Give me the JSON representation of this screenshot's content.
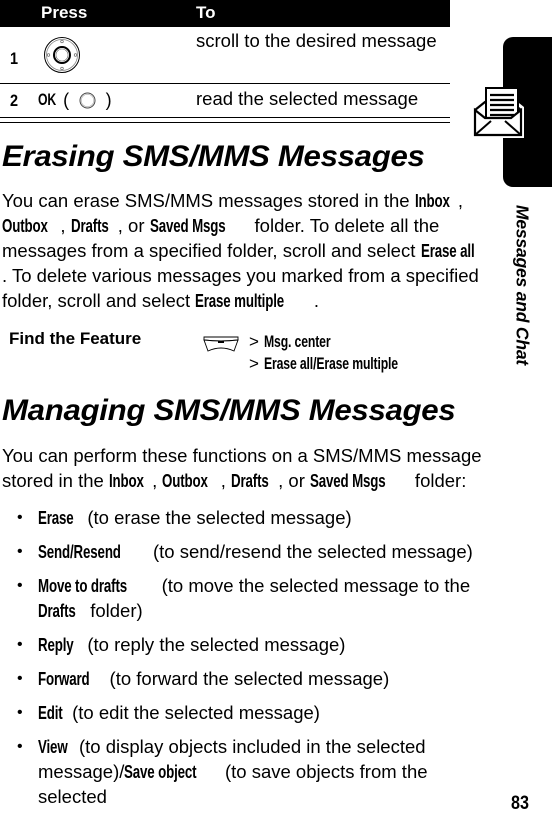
{
  "table": {
    "headers": {
      "press": "Press",
      "to": "To"
    },
    "rows": [
      {
        "num": "1",
        "press_icon": "nav-key-icon",
        "desc": "scroll to the desired message"
      },
      {
        "num": "2",
        "press_label": "OK",
        "press_icon": "center-select-key-icon",
        "open_paren": "(",
        "close_paren": ")",
        "desc": "read the selected message"
      }
    ]
  },
  "side_tab": {
    "icon": "envelope-message-icon",
    "label": "Messages and Chat"
  },
  "erase_section": {
    "title": "Erasing SMS/MMS Messages",
    "paragraph": [
      {
        "t": "You can erase SMS/MMS messages stored in the "
      },
      {
        "b": "Inbox"
      },
      {
        "t": ", "
      },
      {
        "b": "Outbox"
      },
      {
        "t": ", "
      },
      {
        "b": "Drafts"
      },
      {
        "t": ", or "
      },
      {
        "b": "Saved Msgs"
      },
      {
        "t": " folder. To delete all the messages from a specified folder, scroll and select "
      },
      {
        "b": "Erase all"
      },
      {
        "t": ". To delete various messages you marked from a specified folder, scroll and select "
      },
      {
        "b": "Erase multiple"
      },
      {
        "t": "."
      }
    ]
  },
  "find_feature": {
    "label": "Find the Feature",
    "key_icon": "menu-key-icon",
    "path": [
      "Msg. center",
      "Erase all/Erase multiple"
    ],
    "separator": ">"
  },
  "manage_section": {
    "title": "Managing SMS/MMS Messages",
    "paragraph": [
      {
        "t": "You can perform these functions on a SMS/MMS message stored in the "
      },
      {
        "b": "Inbox"
      },
      {
        "t": ", "
      },
      {
        "b": "Outbox"
      },
      {
        "t": ", "
      },
      {
        "b": "Drafts"
      },
      {
        "t": ", or "
      },
      {
        "b": "Saved Msgs"
      },
      {
        "t": " folder:"
      }
    ],
    "bullets": [
      [
        {
          "b": "Erase"
        },
        {
          "t": " (to erase the selected message)"
        }
      ],
      [
        {
          "b": "Send/Resend"
        },
        {
          "t": " (to send/resend the selected message)"
        }
      ],
      [
        {
          "b": "Move to drafts"
        },
        {
          "t": " (to move the selected message to the "
        },
        {
          "b": "Drafts"
        },
        {
          "t": " folder)"
        }
      ],
      [
        {
          "b": "Reply"
        },
        {
          "t": " (to reply the selected message)"
        }
      ],
      [
        {
          "b": "Forward"
        },
        {
          "t": " (to forward the selected message)"
        }
      ],
      [
        {
          "b": "Edit"
        },
        {
          "t": " (to edit the selected message)"
        }
      ],
      [
        {
          "b": "View"
        },
        {
          "t": " (to display objects included in the selected message)/"
        },
        {
          "b": "Save object"
        },
        {
          "t": " (to save objects from the selected"
        }
      ]
    ],
    "bullet_glyph": "•"
  },
  "page_number": "83"
}
